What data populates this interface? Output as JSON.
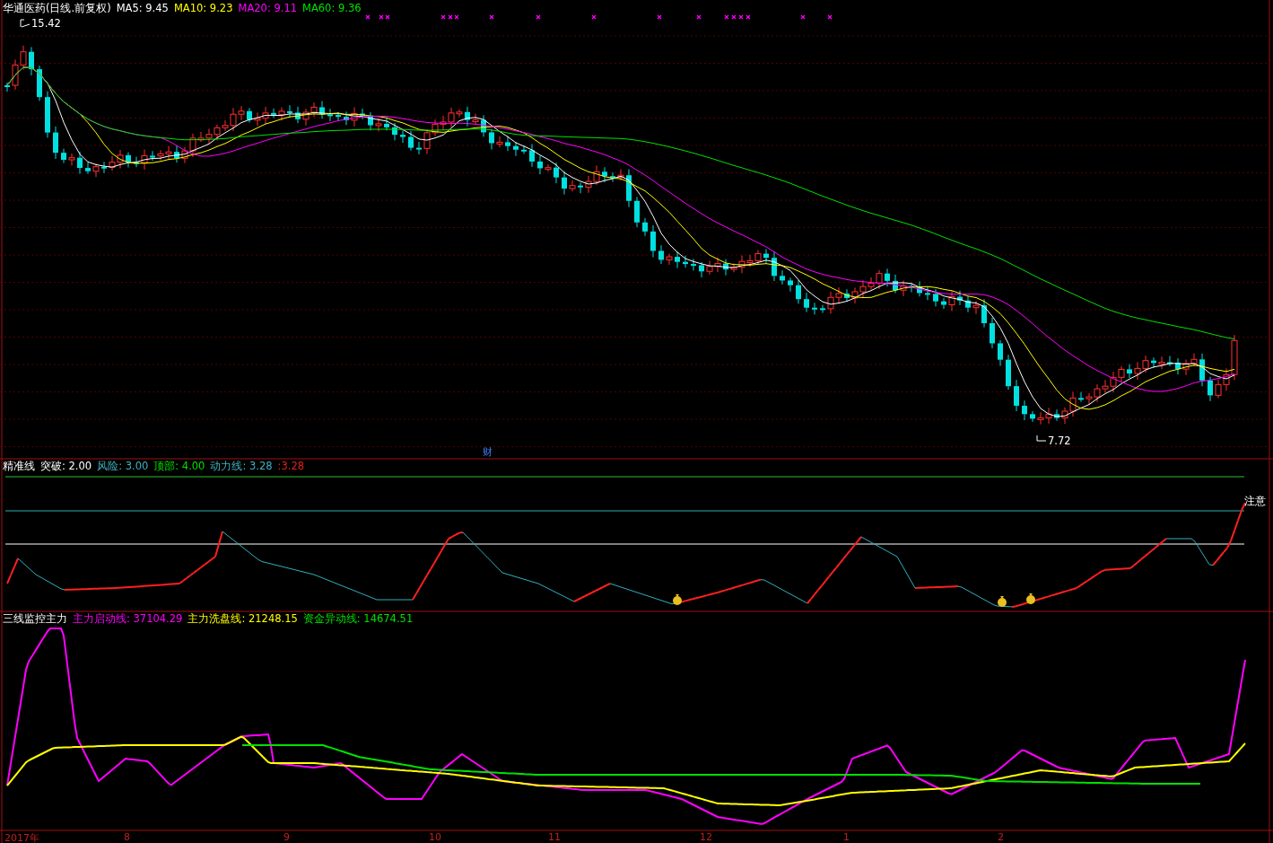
{
  "main_panel": {
    "title": "华通医药(日线.前复权)",
    "indicators": [
      {
        "label": "MA5: 9.45",
        "color": "#ffffff"
      },
      {
        "label": "MA10: 9.23",
        "color": "#ffff00"
      },
      {
        "label": "MA20: 9.11",
        "color": "#ff00ff"
      },
      {
        "label": "MA60: 9.36",
        "color": "#00e000"
      }
    ],
    "high_label": "15.42",
    "low_label": "7.72",
    "event_marker": "财"
  },
  "signal_panel": {
    "title": "精准线",
    "indicators": [
      {
        "label": "突破: 2.00",
        "color": "#ffffff"
      },
      {
        "label": "风险: 3.00",
        "color": "#40b0c0"
      },
      {
        "label": "顶部: 4.00",
        "color": "#00e000"
      },
      {
        "label": "动力线: 3.28",
        "color": "#40b0c0"
      },
      {
        "label": ":3.28",
        "color": "#e02020"
      }
    ],
    "end_label": "注意"
  },
  "flow_panel": {
    "title": "三线监控主力",
    "indicators": [
      {
        "label": "主力启动线: 37104.29",
        "color": "#ff00ff"
      },
      {
        "label": "主力洗盘线: 21248.15",
        "color": "#ffff00"
      },
      {
        "label": "资金异动线: 14674.51",
        "color": "#00e000"
      }
    ]
  },
  "x_axis": [
    "2017年",
    "8",
    "9",
    "10",
    "11",
    "12",
    "1",
    "2"
  ]
}
